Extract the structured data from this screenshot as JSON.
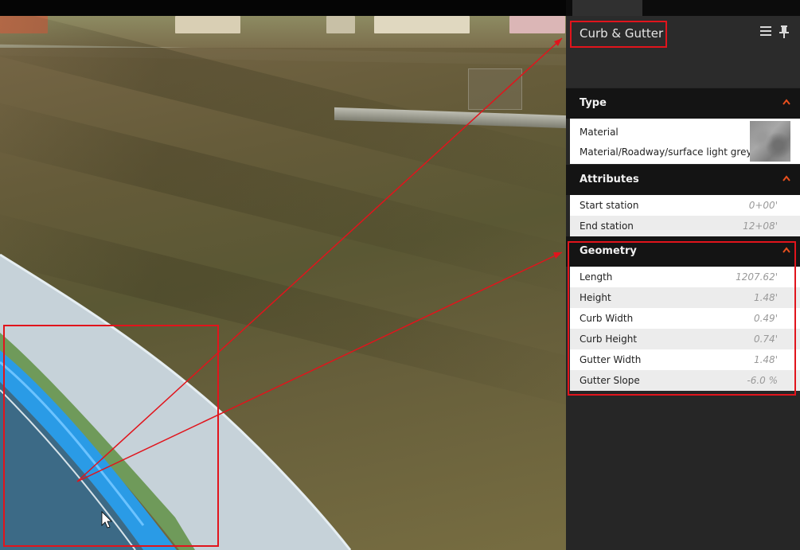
{
  "panel": {
    "title": "Curb & Gutter",
    "menu_icon": "hamburger-menu-icon",
    "pin_icon": "pin-icon"
  },
  "sections": {
    "type": {
      "title": "Type",
      "material_label": "Material",
      "material_value": "Material/Roadway/surface light grey c..."
    },
    "attributes": {
      "title": "Attributes",
      "rows": [
        {
          "label": "Start station",
          "value": "0+00'"
        },
        {
          "label": "End station",
          "value": "12+08'"
        }
      ]
    },
    "geometry": {
      "title": "Geometry",
      "rows": [
        {
          "label": "Length",
          "value": "1207.62'"
        },
        {
          "label": "Height",
          "value": "1.48'"
        },
        {
          "label": "Curb Width",
          "value": "0.49'"
        },
        {
          "label": "Curb Height",
          "value": "0.74'"
        },
        {
          "label": "Gutter Width",
          "value": "1.48'"
        },
        {
          "label": "Gutter Slope",
          "value": "-6.0 %"
        }
      ]
    }
  },
  "colors": {
    "accent": "#e8501e",
    "highlight_red": "#e1141c",
    "panel_bg": "#262626",
    "section_head_bg": "#141414",
    "curb_blue": "#2a9be6"
  }
}
